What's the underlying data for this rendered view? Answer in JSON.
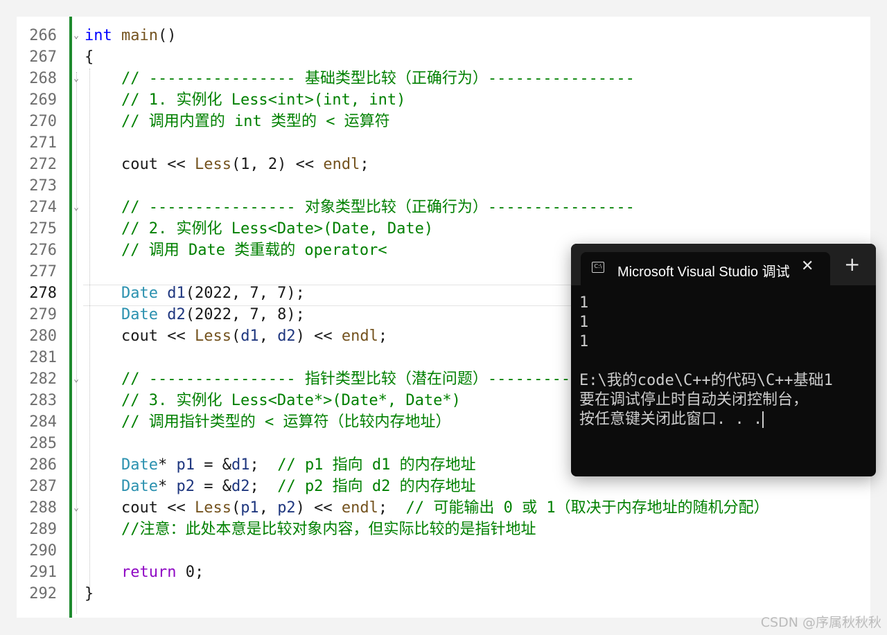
{
  "editor": {
    "current_line": "278",
    "lines": [
      {
        "no": "266",
        "code": "int main()"
      },
      {
        "no": "267",
        "code": "{"
      },
      {
        "no": "268",
        "code": "    // ---------------- 基础类型比较（正确行为）----------------"
      },
      {
        "no": "269",
        "code": "    // 1. 实例化 Less<int>(int, int)"
      },
      {
        "no": "270",
        "code": "    // 调用内置的 int 类型的 < 运算符"
      },
      {
        "no": "271",
        "code": ""
      },
      {
        "no": "272",
        "code": "    cout << Less(1, 2) << endl;"
      },
      {
        "no": "273",
        "code": ""
      },
      {
        "no": "274",
        "code": "    // ---------------- 对象类型比较（正确行为）----------------"
      },
      {
        "no": "275",
        "code": "    // 2. 实例化 Less<Date>(Date, Date)"
      },
      {
        "no": "276",
        "code": "    // 调用 Date 类重载的 operator<"
      },
      {
        "no": "277",
        "code": ""
      },
      {
        "no": "278",
        "code": "    Date d1(2022, 7, 7);"
      },
      {
        "no": "279",
        "code": "    Date d2(2022, 7, 8);"
      },
      {
        "no": "280",
        "code": "    cout << Less(d1, d2) << endl;"
      },
      {
        "no": "281",
        "code": ""
      },
      {
        "no": "282",
        "code": "    // ---------------- 指针类型比较（潜在问题）----------------"
      },
      {
        "no": "283",
        "code": "    // 3. 实例化 Less<Date*>(Date*, Date*)"
      },
      {
        "no": "284",
        "code": "    // 调用指针类型的 < 运算符（比较内存地址）"
      },
      {
        "no": "285",
        "code": ""
      },
      {
        "no": "286",
        "code": "    Date* p1 = &d1;  // p1 指向 d1 的内存地址"
      },
      {
        "no": "287",
        "code": "    Date* p2 = &d2;  // p2 指向 d2 的内存地址"
      },
      {
        "no": "288",
        "code": "    cout << Less(p1, p2) << endl;  // 可能输出 0 或 1（取决于内存地址的随机分配）"
      },
      {
        "no": "289",
        "code": "    //注意：此处本意是比较对象内容，但实际比较的是指针地址"
      },
      {
        "no": "290",
        "code": ""
      },
      {
        "no": "291",
        "code": "    return 0;"
      },
      {
        "no": "292",
        "code": "}"
      }
    ],
    "fold_markers": [
      "266",
      "268",
      "274",
      "282",
      "288"
    ]
  },
  "console": {
    "title": "Microsoft Visual Studio 调试控制台",
    "icon": "console-icon",
    "close_glyph": "✕",
    "new_tab_glyph": "+",
    "output": [
      "1",
      "1",
      "1",
      "",
      "E:\\我的code\\C++的代码\\C++基础1",
      "要在调试停止时自动关闭控制台，",
      "按任意键关闭此窗口. . ."
    ]
  },
  "watermark": "CSDN @序属秋秋秋"
}
